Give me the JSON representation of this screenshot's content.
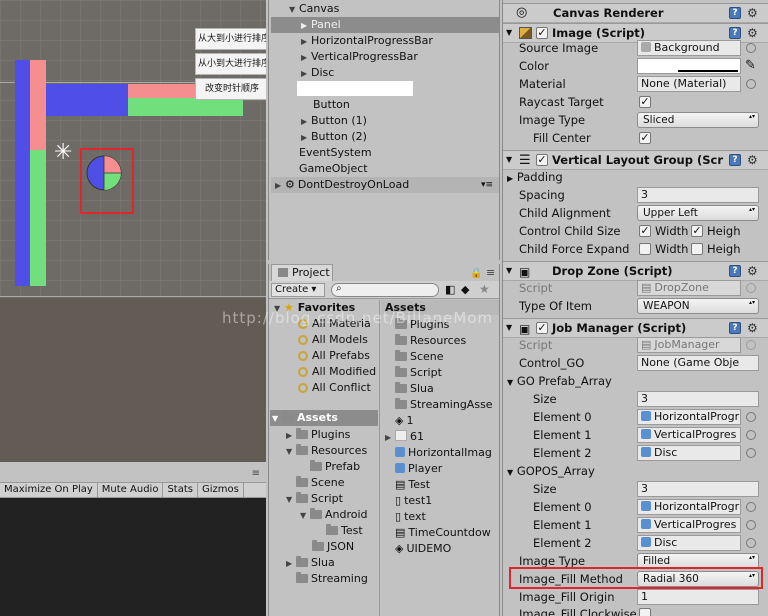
{
  "scene": {
    "buttons": [
      "从大到小进行排序",
      "从小到大进行排序",
      "改变时针顺序"
    ]
  },
  "game": {
    "toolbar": [
      "Maximize On Play",
      "Mute Audio",
      "Stats",
      "Gizmos"
    ]
  },
  "hierarchy": {
    "items": [
      {
        "label": "Canvas",
        "expanded": true
      },
      {
        "label": "Panel",
        "selected": true
      },
      {
        "label": "HorizontalProgressBar"
      },
      {
        "label": "VerticalProgressBar"
      },
      {
        "label": "Disc"
      },
      {
        "label": ""
      },
      {
        "label": "Button"
      },
      {
        "label": "Button (1)"
      },
      {
        "label": "Button (2)"
      },
      {
        "label": "EventSystem"
      },
      {
        "label": "GameObject"
      },
      {
        "label": "DontDestroyOnLoad"
      }
    ]
  },
  "project": {
    "tab": "Project",
    "create": "Create",
    "favorites": {
      "title": "Favorites",
      "items": [
        "All Materia",
        "All Models",
        "All Prefabs",
        "All Modified",
        "All Conflict"
      ]
    },
    "assets_tree": [
      "Assets",
      "Plugins",
      "Resources",
      "Prefab",
      "Scene",
      "Script",
      "Android",
      "Test",
      "JSON",
      "Slua",
      "Streaming"
    ],
    "assets_header": "Assets",
    "assets_list": [
      "Plugins",
      "Resources",
      "Scene",
      "Script",
      "Slua",
      "StreamingAsse",
      "1",
      "61",
      "HorizontalImag",
      "Player",
      "Test",
      "test1",
      "text",
      "TimeCountdow",
      "UIDEMO"
    ]
  },
  "inspector": {
    "canvas_renderer": "Canvas Renderer",
    "image": {
      "title": "Image (Script)",
      "source_image_label": "Source Image",
      "source_image": "Background",
      "color_label": "Color",
      "material_label": "Material",
      "material": "None (Material)",
      "raycast_label": "Raycast Target",
      "image_type_label": "Image Type",
      "image_type": "Sliced",
      "fill_center_label": "Fill Center"
    },
    "vlg": {
      "title": "Vertical Layout Group (Scr",
      "padding": "Padding",
      "spacing_label": "Spacing",
      "spacing": "3",
      "child_align_label": "Child Alignment",
      "child_align": "Upper Left",
      "control_size_label": "Control Child Size",
      "force_expand_label": "Child Force Expand",
      "width": "Width",
      "height": "Heigh"
    },
    "drop_zone": {
      "title": "Drop Zone (Script)",
      "script_label": "Script",
      "script": "DropZone",
      "type_label": "Type Of Item",
      "type": "WEAPON"
    },
    "job_manager": {
      "title": "Job Manager (Script)",
      "script_label": "Script",
      "script": "JobManager",
      "control_label": "Control_GO",
      "control": "None (Game Obje",
      "prefab_array": "GO Prefab_Array",
      "size_label": "Size",
      "size": "3",
      "elements": [
        {
          "label": "Element 0",
          "value": "HorizontalProgr"
        },
        {
          "label": "Element 1",
          "value": "VerticalProgres"
        },
        {
          "label": "Element 2",
          "value": "Disc"
        }
      ],
      "gopos_array": "GOPOS_Array",
      "gopos_size": "3",
      "gopos_elements": [
        {
          "label": "Element 0",
          "value": "HorizontalProgr"
        },
        {
          "label": "Element 1",
          "value": "VerticalProgres"
        },
        {
          "label": "Element 2",
          "value": "Disc"
        }
      ],
      "image_type_label": "Image Type",
      "image_type": "Filled",
      "fill_method_label": "Image_Fill Method",
      "fill_method": "Radial 360",
      "fill_origin_label": "Image_Fill Origin",
      "fill_origin": "1",
      "fill_clockwise_label": "Image_Fill Clockwise"
    }
  },
  "watermark": "http://blog.csdn.net/BillaneMom"
}
